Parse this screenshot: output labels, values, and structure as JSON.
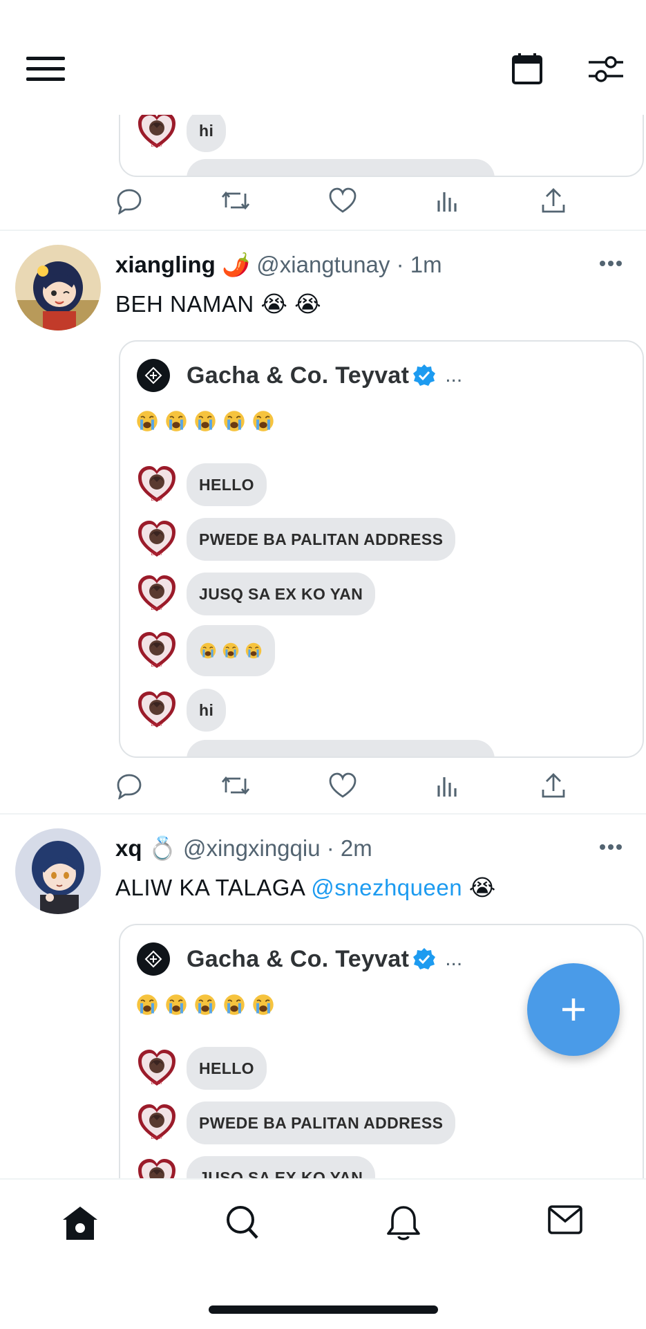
{
  "header": {
    "menu_icon": "hamburger-icon",
    "calendar_icon": "calendar-icon",
    "settings_icon": "sliders-icon"
  },
  "partial_post": {
    "bubbles": [
      "hi"
    ]
  },
  "posts": [
    {
      "name": "xiangling",
      "name_emoji": "🌶️",
      "handle": "@xiangtunay",
      "time": "· 1m",
      "text": "BEH NAMAN 😭 😭",
      "quote": {
        "name": "Gacha & Co. Teyvat",
        "dots": "...",
        "emojis": "😭 😭 😭 😭 😭",
        "bubbles": [
          "HELLO",
          "PWEDE BA PALITAN ADDRESS",
          "JUSQ SA EX KO YAN",
          "😭 😭 😭",
          "hi"
        ]
      }
    },
    {
      "name": "xq",
      "name_emoji": "💍",
      "handle": "@xingxingqiu",
      "time": "· 2m",
      "text_before": "ALIW KA TALAGA ",
      "mention": "@snezhqueen",
      "text_after": " 😭",
      "quote": {
        "name": "Gacha & Co. Teyvat",
        "dots": "...",
        "emojis": "😭 😭 😭 😭 😭",
        "bubbles": [
          "HELLO",
          "PWEDE BA PALITAN ADDRESS",
          "JUSQ SA EX KO YAN"
        ]
      }
    }
  ],
  "actions": [
    "reply-icon",
    "retweet-icon",
    "like-icon",
    "views-icon",
    "share-icon"
  ],
  "fab_icon": "plus-icon",
  "bottom_nav": [
    "home-icon",
    "search-icon",
    "notifications-icon",
    "messages-icon"
  ],
  "colors": {
    "accent": "#4a9be8",
    "text": "#0f1419",
    "secondary": "#536471",
    "bubble": "#e5e7ea"
  }
}
